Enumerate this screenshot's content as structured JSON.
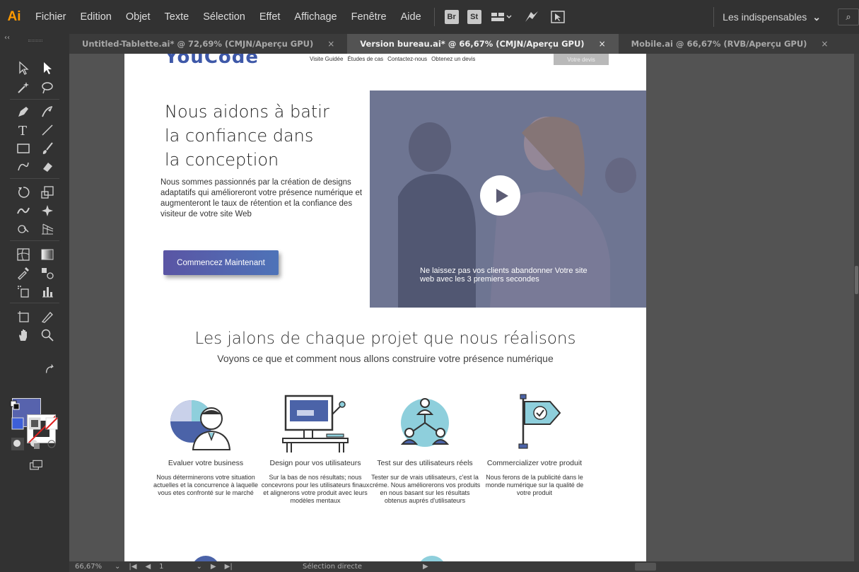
{
  "app": {
    "logo": "Ai"
  },
  "menu": [
    "Fichier",
    "Edition",
    "Objet",
    "Texte",
    "Sélection",
    "Effet",
    "Affichage",
    "Fenêtre",
    "Aide"
  ],
  "bridge_badges": [
    "Br",
    "St"
  ],
  "workspace": {
    "label": "Les indispensables",
    "chevron": "⌄"
  },
  "search": {
    "icon": "⌕"
  },
  "tabs": [
    {
      "label": "Untitled-Tablette.ai* @ 72,69% (CMJN/Aperçu GPU)",
      "close": "×",
      "active": false
    },
    {
      "label": "Version bureau.ai* @ 66,67% (CMJN/Aperçu GPU)",
      "close": "×",
      "active": true
    },
    {
      "label": "Mobile.ai @ 66,67% (RVB/Aperçu GPU)",
      "close": "×",
      "active": false
    }
  ],
  "toolbar": {
    "collapse": "‹‹"
  },
  "artboard": {
    "logo": "YouCode",
    "nav": [
      "Visite Guidée",
      "Études de cas",
      "Contactez-nous",
      "Obtenez un devis"
    ],
    "devis_button": "Votre devis",
    "headline": [
      "Nous aidons à batir",
      "la confiance dans",
      "la conception"
    ],
    "intro": "Nous sommes passionnés par la création de designs adaptatifs qui amélioreront votre présence numérique et augmenteront le taux de rétention et la confiance des visiteur de votre site Web",
    "cta": "Commencez Maintenant",
    "video_caption": "Ne laissez pas vos clients abandonner Votre site web avec les 3 premiers secondes",
    "section_title": "Les jalons de chaque projet que nous réalisons",
    "section_subtitle": "Voyons ce que et comment nous allons construire votre présence numérique",
    "features": [
      {
        "icon": "user-chart-icon",
        "title": "Evaluer votre business",
        "desc": "Nous déterminerons votre situation actuelles et la concurrence à laquelle vous etes confronté sur le marché"
      },
      {
        "icon": "desk-computer-icon",
        "title": "Design pour vos utilisateurs",
        "desc": "Sur la bas de nos résultats; nous concevrons pour les utilisateurs finaux et alignerons votre produit avec leurs modèles mentaux"
      },
      {
        "icon": "user-network-icon",
        "title": "Test sur des utilisateurs réels",
        "desc": "Tester sur de vrais utilisateurs, c'est la créme. Nous améliorerons vos produits en nous basant sur les résultats obtenus auprés d'utilisateurs"
      },
      {
        "icon": "flag-check-icon",
        "title": "Commercializer votre produit",
        "desc": "Nous ferons de la publicité dans le monde numérique sur la qualité de votre produit"
      }
    ]
  },
  "statusbar": {
    "zoom": "66,67%",
    "page": "1",
    "status": "Sélection directe"
  },
  "colors": {
    "fill": "#5763ad",
    "stroke": "#ffffff",
    "accent_teal": "#8ecfdc",
    "icon_blue": "#4b63a8"
  }
}
